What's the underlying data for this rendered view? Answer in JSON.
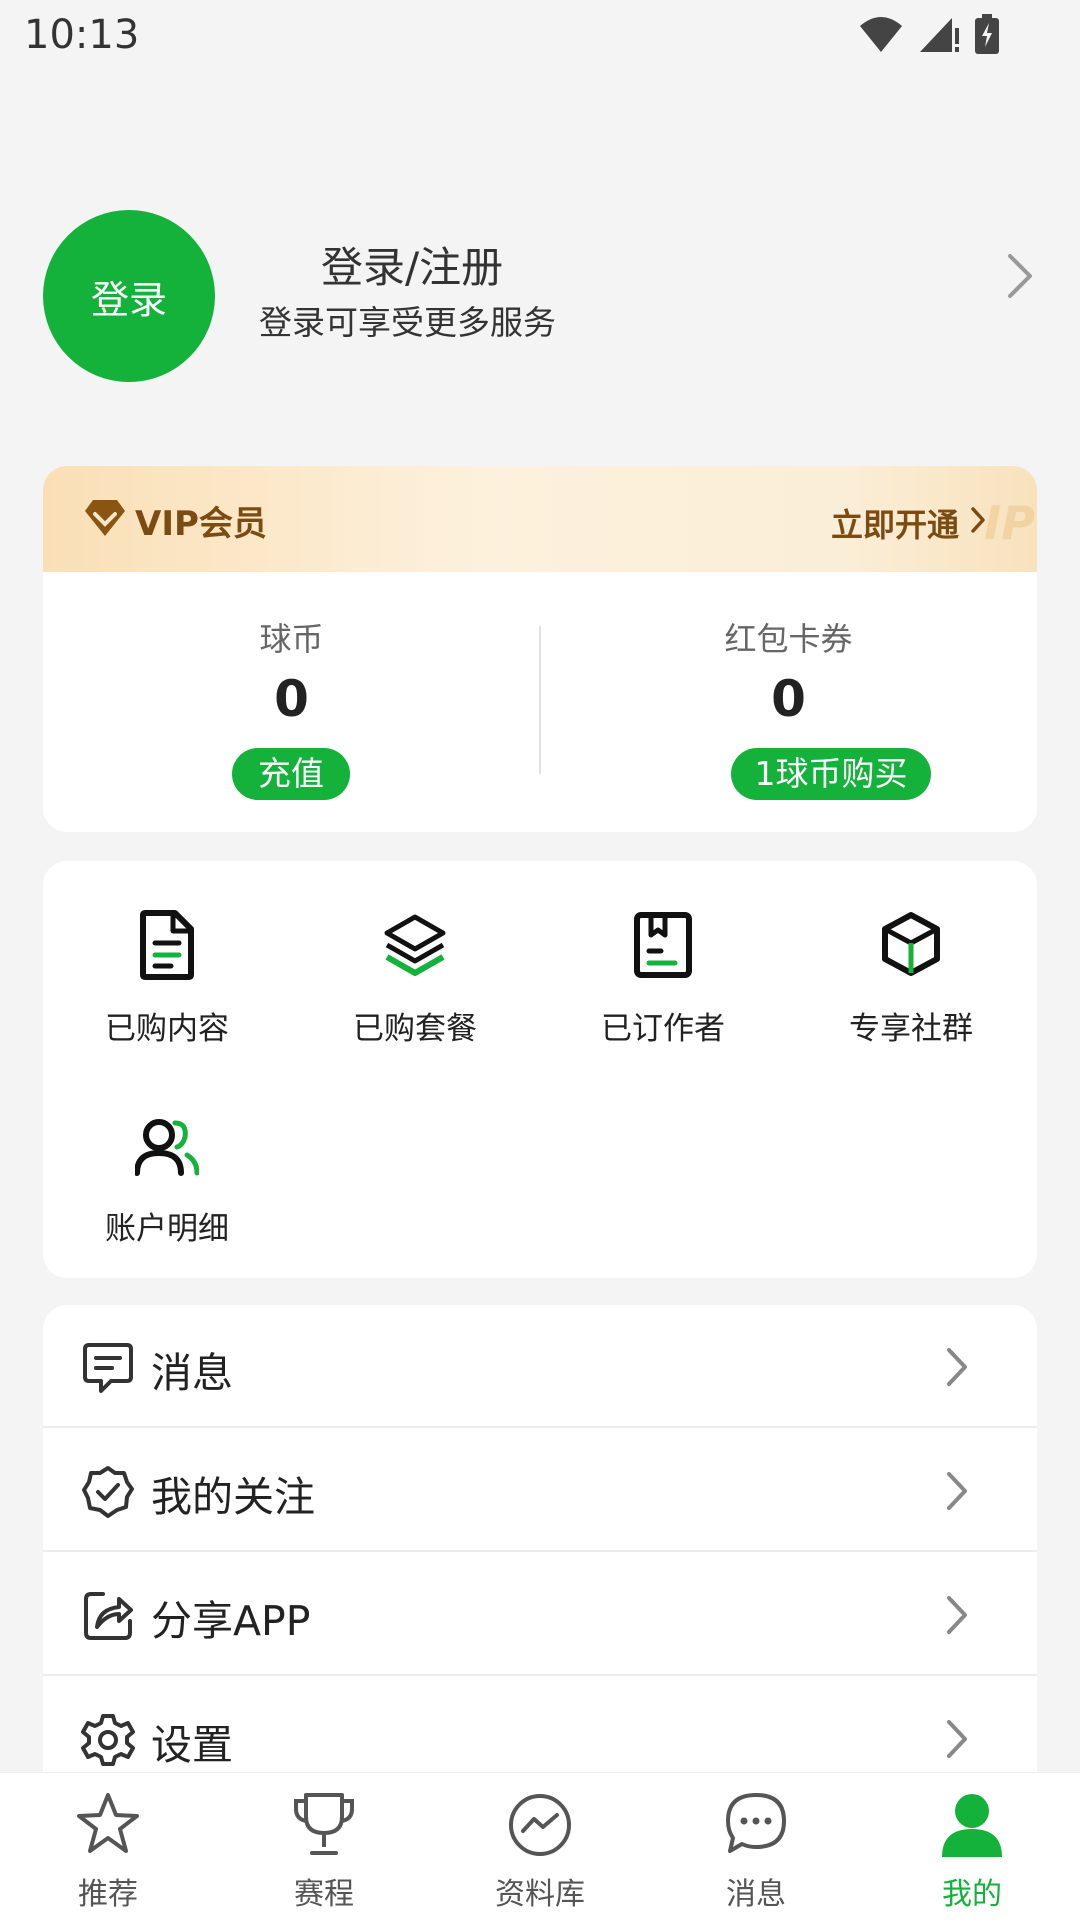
{
  "status_bar": {
    "time": "10:13"
  },
  "profile": {
    "avatar_label": "登录",
    "title": "登录/注册",
    "subtitle": "登录可享受更多服务"
  },
  "vip": {
    "title": "VIP会员",
    "action": "立即开通",
    "watermark": "IP"
  },
  "wallet": {
    "coins": {
      "label": "球币",
      "value": "0",
      "button": "充值"
    },
    "coupons": {
      "label": "红包卡券",
      "value": "0",
      "button": "1球币购买"
    }
  },
  "grid": {
    "items": [
      {
        "label": "已购内容",
        "icon": "document-icon"
      },
      {
        "label": "已购套餐",
        "icon": "layers-icon"
      },
      {
        "label": "已订作者",
        "icon": "bookmark-icon"
      },
      {
        "label": "专享社群",
        "icon": "cube-icon"
      },
      {
        "label": "账户明细",
        "icon": "users-icon"
      }
    ]
  },
  "menu": {
    "items": [
      {
        "label": "消息",
        "icon": "message-icon"
      },
      {
        "label": "我的关注",
        "icon": "verified-icon"
      },
      {
        "label": "分享APP",
        "icon": "share-icon"
      },
      {
        "label": "设置",
        "icon": "gear-icon"
      }
    ]
  },
  "nav": {
    "items": [
      {
        "label": "推荐",
        "icon": "star-icon"
      },
      {
        "label": "赛程",
        "icon": "trophy-icon"
      },
      {
        "label": "资料库",
        "icon": "trend-icon"
      },
      {
        "label": "消息",
        "icon": "chat-icon"
      },
      {
        "label": "我的",
        "icon": "person-icon",
        "active": true
      }
    ]
  },
  "colors": {
    "accent": "#14b23b",
    "vip_text": "#7b4b12",
    "background": "#f4f4f4"
  }
}
